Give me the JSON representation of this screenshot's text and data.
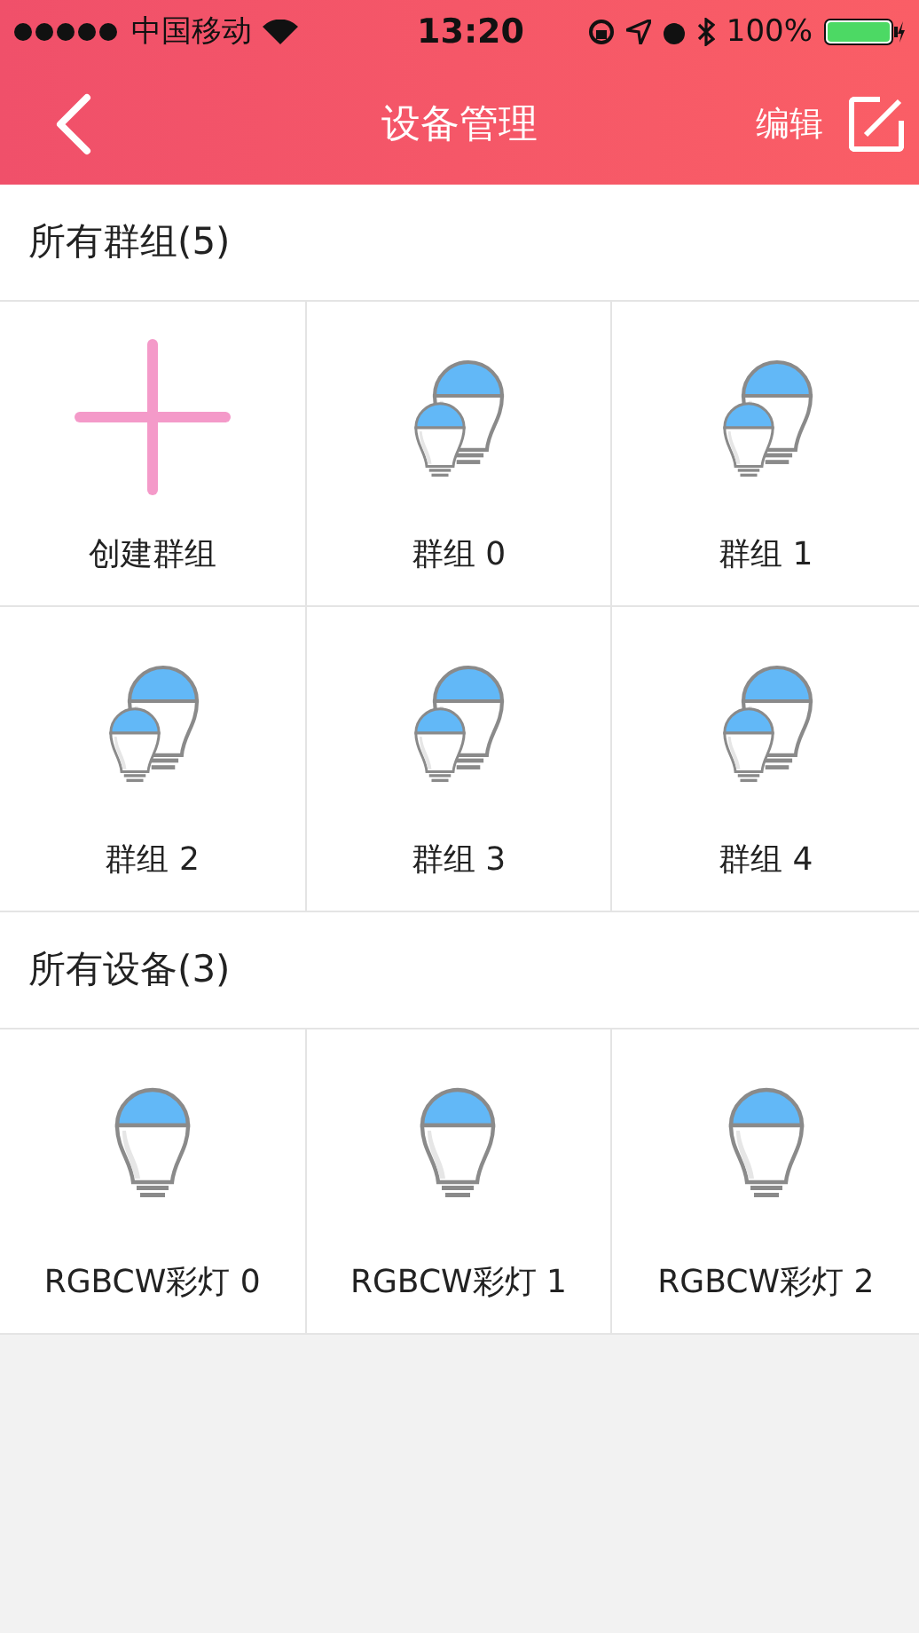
{
  "status_bar": {
    "carrier": "中国移动",
    "time": "13:20",
    "battery": "100%"
  },
  "nav": {
    "title": "设备管理",
    "edit": "编辑"
  },
  "groups": {
    "title": "所有群组(5)",
    "items": [
      {
        "kind": "add",
        "label": "创建群组"
      },
      {
        "kind": "group",
        "label": "群组 0"
      },
      {
        "kind": "group",
        "label": "群组 1"
      },
      {
        "kind": "group",
        "label": "群组 2"
      },
      {
        "kind": "group",
        "label": "群组 3"
      },
      {
        "kind": "group",
        "label": "群组 4"
      }
    ]
  },
  "devices": {
    "title": "所有设备(3)",
    "items": [
      {
        "kind": "bulb",
        "label": "RGBCW彩灯 0"
      },
      {
        "kind": "bulb",
        "label": "RGBCW彩灯 1"
      },
      {
        "kind": "bulb",
        "label": "RGBCW彩灯 2"
      }
    ]
  }
}
